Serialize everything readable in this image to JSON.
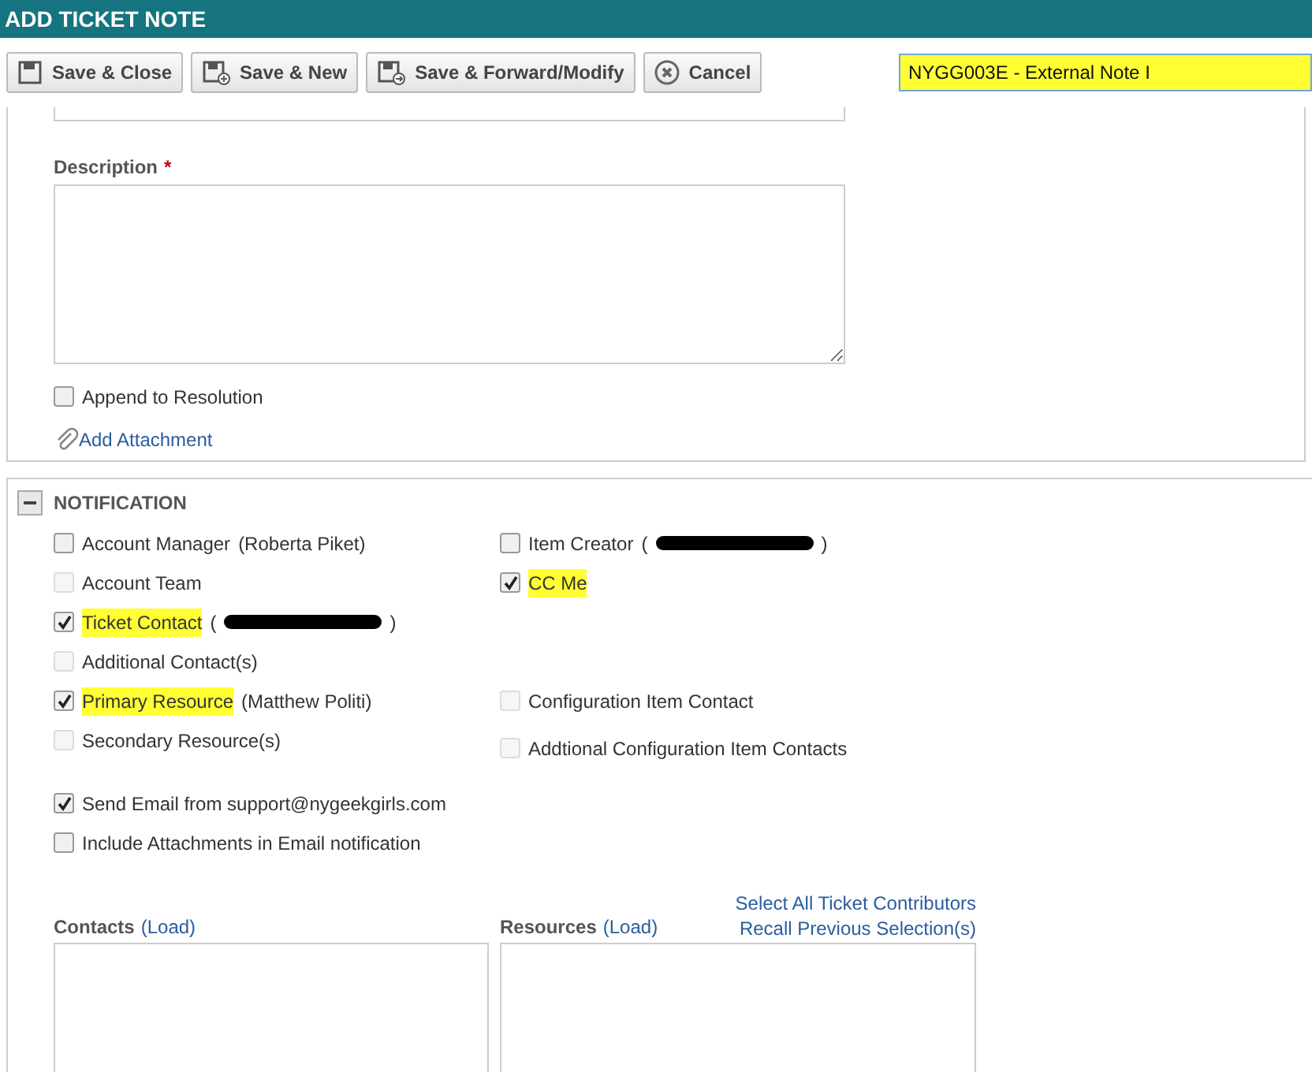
{
  "window": {
    "title": "ADD TICKET NOTE"
  },
  "toolbar": {
    "buttons": [
      {
        "label": "Save & Close",
        "kind": "save"
      },
      {
        "label": "Save & New",
        "kind": "new"
      },
      {
        "label": "Save & Forward/Modify",
        "kind": "forward"
      },
      {
        "label": "Cancel",
        "kind": "cancel"
      }
    ],
    "title_field": {
      "value": "NYGG003E - External Note I",
      "highlighted": true
    }
  },
  "details": {
    "description_label": "Description",
    "required_mark": "*",
    "append": {
      "label": "Append to Resolution",
      "checked": false,
      "disabled": false,
      "highlighted": false
    },
    "attachment_link": "Add Attachment"
  },
  "notification": {
    "title": "NOTIFICATION",
    "expanded": true,
    "rows": [
      {
        "left": {
          "label": "Account Manager",
          "detail": "(Roberta Piket)",
          "checked": false,
          "disabled": false,
          "highlighted": false
        },
        "right": {
          "label": "Item Creator",
          "detail": "(",
          "redacted": true,
          "detail_end": ")",
          "checked": false,
          "disabled": false,
          "highlighted": false
        }
      },
      {
        "left": {
          "label": "Account Team",
          "checked": false,
          "disabled": true,
          "highlighted": false
        },
        "right": {
          "label": "CC Me",
          "checked": true,
          "disabled": false,
          "highlighted": true
        }
      },
      {
        "left": {
          "label": "Ticket Contact",
          "detail": "(",
          "redacted": true,
          "detail_end": ")",
          "checked": true,
          "disabled": false,
          "highlighted": true
        }
      },
      {
        "left": {
          "label": "Additional Contact(s)",
          "checked": false,
          "disabled": true,
          "highlighted": false
        }
      },
      {
        "left": {
          "label": "Primary Resource",
          "detail": "(Matthew Politi)",
          "checked": true,
          "disabled": false,
          "highlighted": true
        },
        "right": {
          "label": "Configuration Item Contact",
          "checked": false,
          "disabled": true,
          "highlighted": false
        }
      },
      {
        "left": {
          "label": "Secondary Resource(s)",
          "checked": false,
          "disabled": true,
          "highlighted": false
        },
        "right": {
          "label": "Addtional Configuration Item Contacts",
          "checked": false,
          "disabled": true,
          "highlighted": false
        }
      }
    ],
    "email_options": [
      {
        "label": "Send Email from support@nygeekgirls.com",
        "checked": true,
        "disabled": false,
        "highlighted": false
      },
      {
        "label": "Include Attachments in Email notification",
        "checked": false,
        "disabled": false,
        "highlighted": false
      }
    ],
    "contacts": {
      "label": "Contacts",
      "link": "(Load)"
    },
    "resources": {
      "label": "Resources",
      "link": "(Load)"
    },
    "links": [
      "Select All Ticket Contributors",
      "Recall Previous Selection(s)"
    ]
  }
}
